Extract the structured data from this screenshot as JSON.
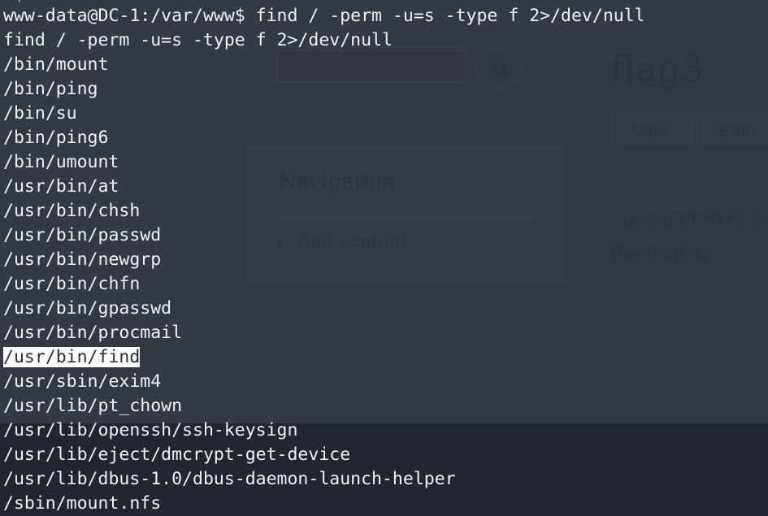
{
  "colors": {
    "terminal_bg_lower": "#22262e",
    "page_bg": "#343a44",
    "panel_bg": "#363c46",
    "terminal_text": "#f2f2f2",
    "selection_bg": "#ffffff",
    "selection_fg": "#2a2f38",
    "link": "#2b3642"
  },
  "webpage": {
    "site_title": "flag3",
    "search": {
      "value": "",
      "placeholder": "",
      "icon": "search-icon"
    },
    "tabs": [
      {
        "label": "View",
        "active": true
      },
      {
        "label": "Edit",
        "active": false
      }
    ],
    "nav_block": {
      "title": "Navigation",
      "links": [
        {
          "label": "Add content",
          "bullet": "triangle-right-icon"
        }
      ]
    },
    "article": {
      "lines": [
        "Special PERMS w",
        "the shadow."
      ]
    }
  },
  "terminal": {
    "clipped_top_line": "~$",
    "prompt_line": "www-data@DC-1:/var/www$ find / -perm -u=s -type f 2>/dev/null",
    "echoed_command": "find / -perm -u=s -type f 2>/dev/null",
    "results": [
      {
        "path": "/bin/mount",
        "selected": false
      },
      {
        "path": "/bin/ping",
        "selected": false
      },
      {
        "path": "/bin/su",
        "selected": false
      },
      {
        "path": "/bin/ping6",
        "selected": false
      },
      {
        "path": "/bin/umount",
        "selected": false
      },
      {
        "path": "/usr/bin/at",
        "selected": false
      },
      {
        "path": "/usr/bin/chsh",
        "selected": false
      },
      {
        "path": "/usr/bin/passwd",
        "selected": false
      },
      {
        "path": "/usr/bin/newgrp",
        "selected": false
      },
      {
        "path": "/usr/bin/chfn",
        "selected": false
      },
      {
        "path": "/usr/bin/gpasswd",
        "selected": false
      },
      {
        "path": "/usr/bin/procmail",
        "selected": false
      },
      {
        "path": "/usr/bin/find",
        "selected": true
      },
      {
        "path": "/usr/sbin/exim4",
        "selected": false
      },
      {
        "path": "/usr/lib/pt_chown",
        "selected": false
      },
      {
        "path": "/usr/lib/openssh/ssh-keysign",
        "selected": false
      },
      {
        "path": "/usr/lib/eject/dmcrypt-get-device",
        "selected": false
      },
      {
        "path": "/usr/lib/dbus-1.0/dbus-daemon-launch-helper",
        "selected": false
      },
      {
        "path": "/sbin/mount.nfs",
        "selected": false
      }
    ]
  }
}
